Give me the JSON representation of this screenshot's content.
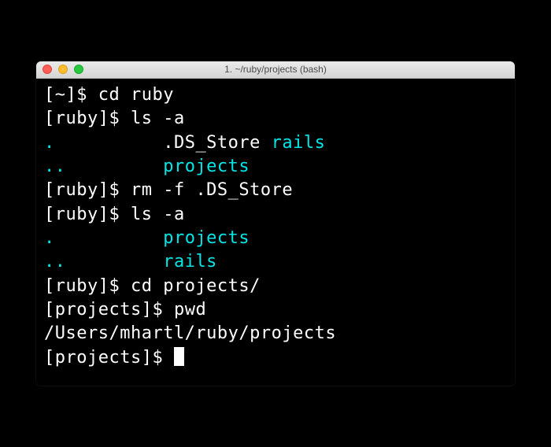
{
  "window": {
    "title": "1. ~/ruby/projects (bash)"
  },
  "colors": {
    "dir": "#00e5e5",
    "fg": "#ffffff",
    "bg": "#000000"
  },
  "lines": {
    "l0": {
      "prompt": "[~]$ ",
      "cmd": "cd ruby"
    },
    "l1": {
      "prompt": "[ruby]$ ",
      "cmd": "ls -a"
    },
    "l2": {
      "a": ".          ",
      "b": ".DS_Store ",
      "c": "rails"
    },
    "l3": {
      "a": "..         ",
      "b": "projects"
    },
    "l4": {
      "prompt": "[ruby]$ ",
      "cmd": "rm -f .DS_Store"
    },
    "l5": {
      "prompt": "[ruby]$ ",
      "cmd": "ls -a"
    },
    "l6": {
      "a": ".          ",
      "b": "projects"
    },
    "l7": {
      "a": "..         ",
      "b": "rails"
    },
    "l8": {
      "prompt": "[ruby]$ ",
      "cmd": "cd projects/"
    },
    "l9": {
      "prompt": "[projects]$ ",
      "cmd": "pwd"
    },
    "l10": {
      "out": "/Users/mhartl/ruby/projects"
    },
    "l11": {
      "prompt": "[projects]$ "
    }
  }
}
